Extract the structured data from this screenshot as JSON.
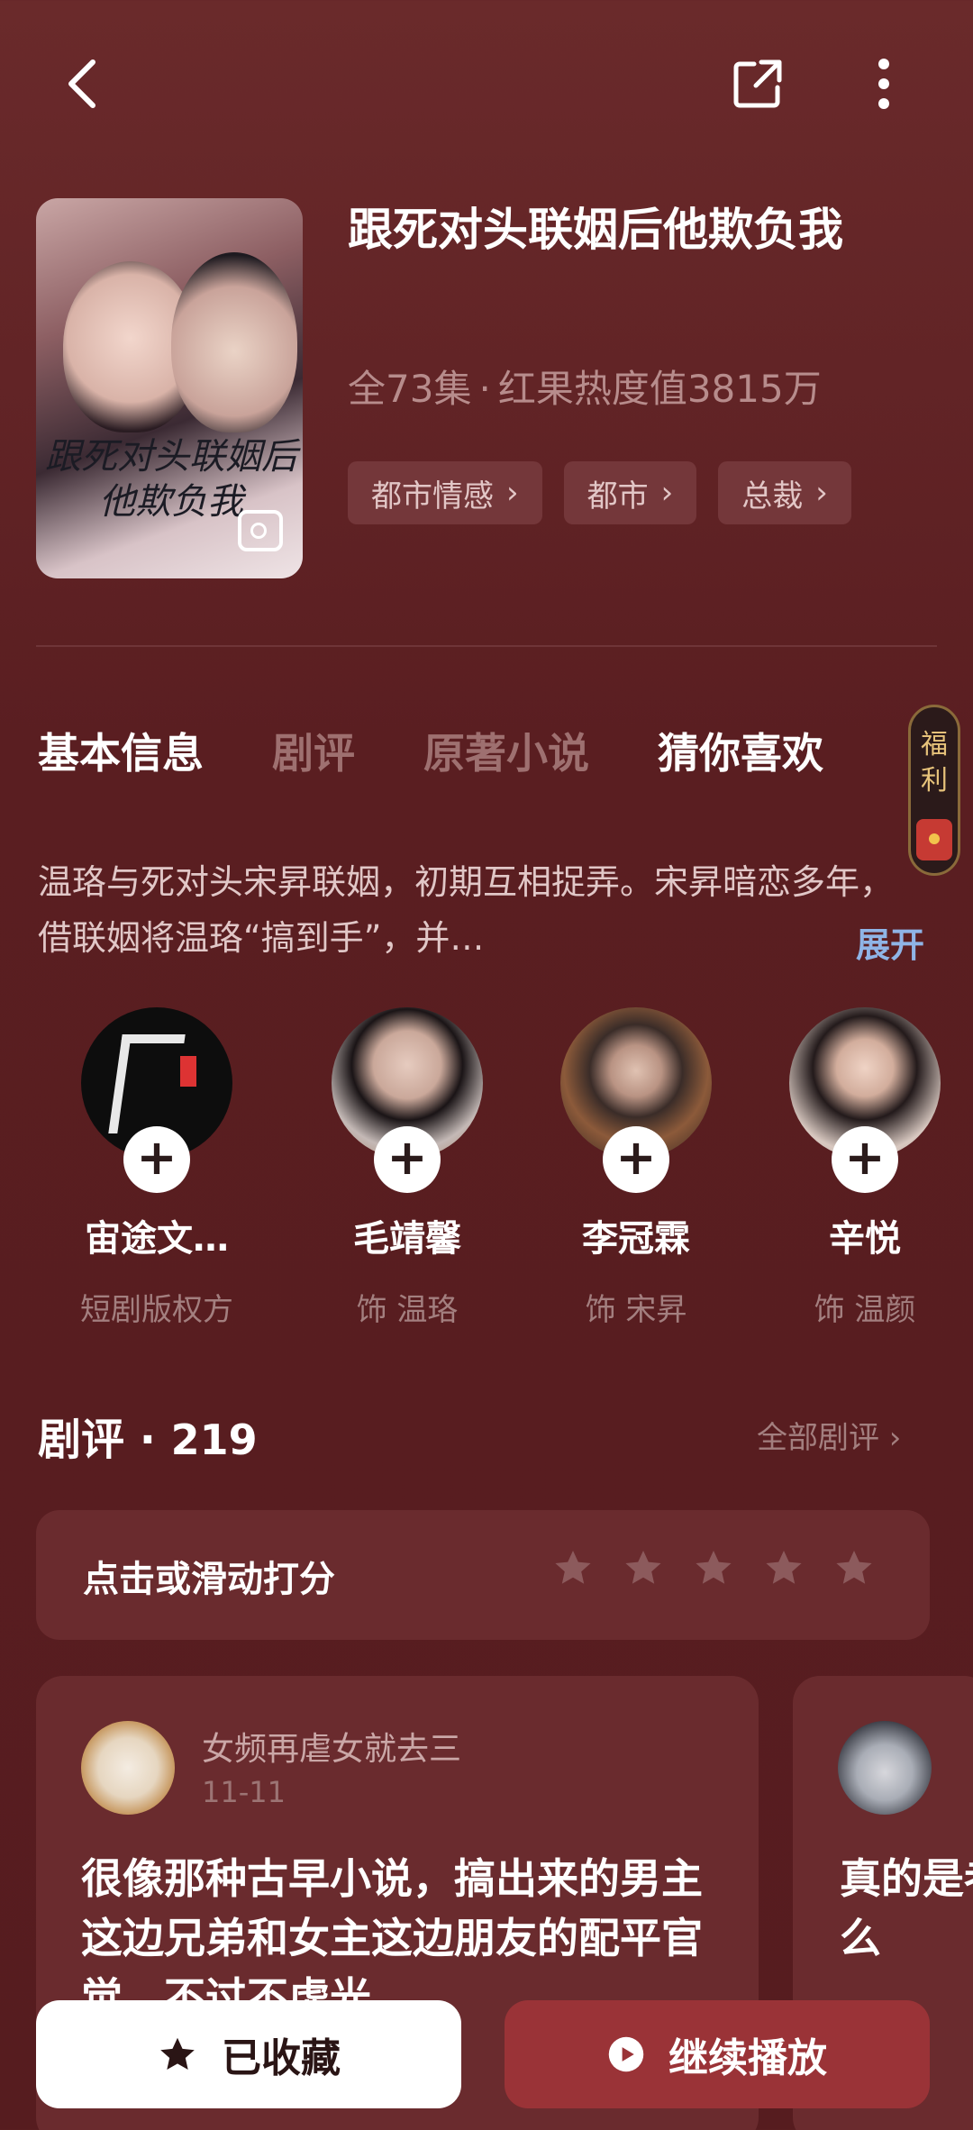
{
  "header": {
    "back_icon": "chevron-left-icon",
    "share_icon": "share-external-icon",
    "more_icon": "vertical-dots-icon"
  },
  "drama": {
    "poster_title": "跟死对头联姻后他欺负我",
    "title": "跟死对头联姻后他欺负我",
    "episodes": "全73集",
    "heat": "红果热度值3815万",
    "tags": [
      "都市情感",
      "都市",
      "总裁"
    ]
  },
  "tabs": [
    "基本信息",
    "剧评",
    "原著小说",
    "猜你喜欢"
  ],
  "fuli": {
    "label": "福利"
  },
  "synopsis": {
    "text": "温珞与死对头宋昇联姻，初期互相捉弄。宋昇暗恋多年，借联姻将温珞“搞到手”，并…",
    "expand": "展开"
  },
  "cast": [
    {
      "name": "宙途文…",
      "role": "短剧版权方"
    },
    {
      "name": "毛靖馨",
      "role": "饰 温珞"
    },
    {
      "name": "李冠霖",
      "role": "饰 宋昇"
    },
    {
      "name": "辛悦",
      "role": "饰 温颜"
    }
  ],
  "reviews": {
    "title": "剧评",
    "count": "219",
    "all_label": "全部剧评",
    "rate_prompt": "点击或滑动打分",
    "rating_stars": 5,
    "items": [
      {
        "user": "女频再虐女就去三",
        "date": "11-11",
        "text": "很像那种古早小说，搞出来的男主这边兄弟和女主这边朋友的配平官觉，不过不虚光"
      },
      {
        "user": "",
        "date": "",
        "text": "真的是者没有有什么"
      }
    ]
  },
  "actions": {
    "favorite_label": "已收藏",
    "play_label": "继续播放"
  },
  "colors": {
    "background": "#5a1e21",
    "card": "#6a2b2e",
    "play_button": "#9a3337",
    "link": "#8fb4e6"
  }
}
